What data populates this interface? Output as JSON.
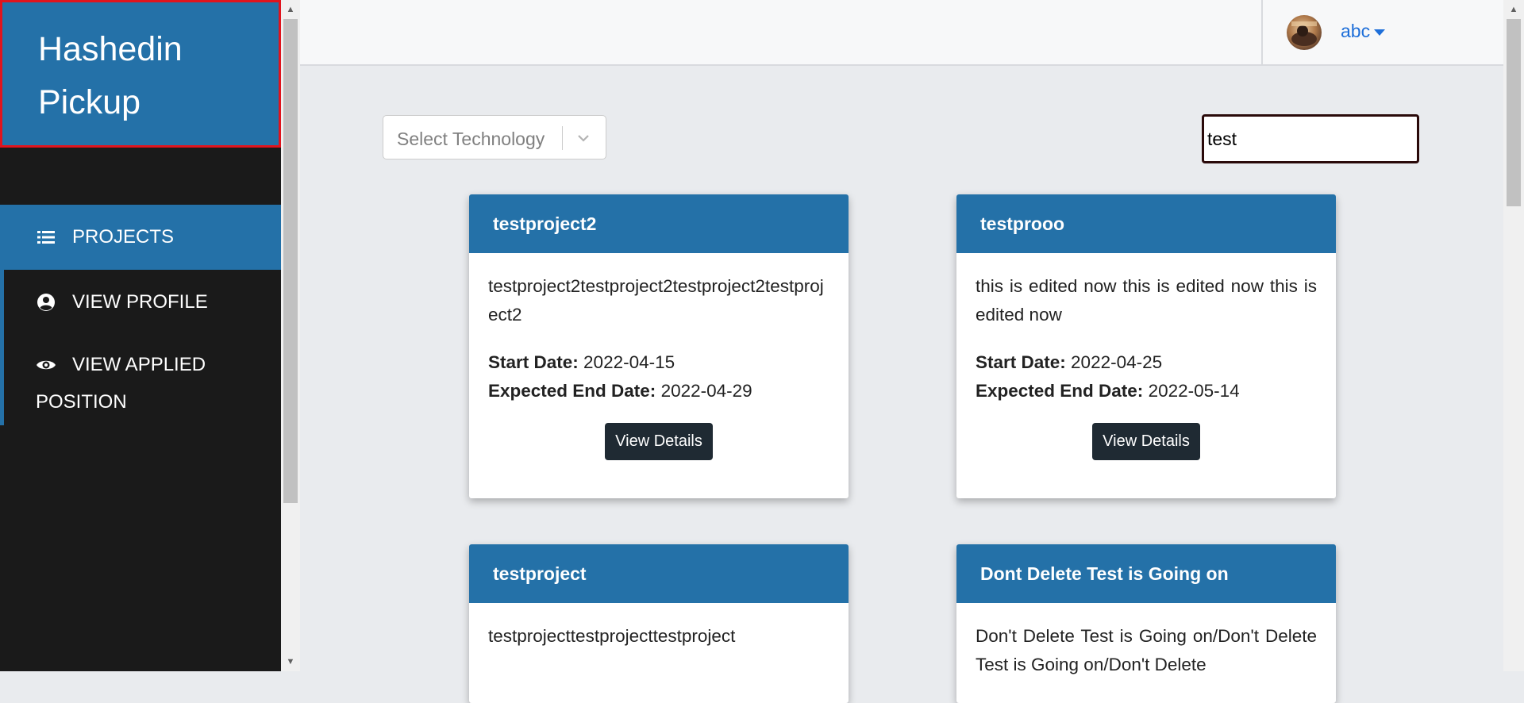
{
  "brand": {
    "line1": "Hashedin",
    "line2": "Pickup"
  },
  "sidebar": {
    "items": [
      {
        "label": "PROJECTS",
        "icon": "list-icon",
        "active": true
      },
      {
        "label": "VIEW PROFILE",
        "icon": "user-circle-icon",
        "active": false
      },
      {
        "label_line1": "VIEW APPLIED",
        "label_line2": "POSITION",
        "icon": "eye-icon",
        "active": false
      }
    ]
  },
  "header": {
    "username": "abc",
    "avatar": "avatar-image"
  },
  "filters": {
    "technology_placeholder": "Select Technology",
    "search_value": "test"
  },
  "projects": [
    {
      "title": "testproject2",
      "description": "testproject2testproject2testproject2testproject2",
      "start_label": "Start Date:",
      "start_date": "2022-04-15",
      "end_label": "Expected End Date:",
      "end_date": "2022-04-29",
      "button": "View Details"
    },
    {
      "title": "testprooo",
      "description": "this is edited now this is edited now this is edited now",
      "start_label": "Start Date:",
      "start_date": "2022-04-25",
      "end_label": "Expected End Date:",
      "end_date": "2022-05-14",
      "button": "View Details"
    },
    {
      "title": "testproject",
      "description": "testprojecttestprojecttestproject"
    },
    {
      "title": "Dont Delete Test is Going on",
      "description": "Don't Delete Test is Going on/Don't Delete Test is Going on/Don't Delete"
    }
  ],
  "colors": {
    "brand_blue": "#2471a8",
    "sidebar_bg": "#1a1a1a",
    "brand_border": "#e0141e",
    "button_dark": "#1f2a33",
    "link_blue": "#1e6fd9"
  }
}
